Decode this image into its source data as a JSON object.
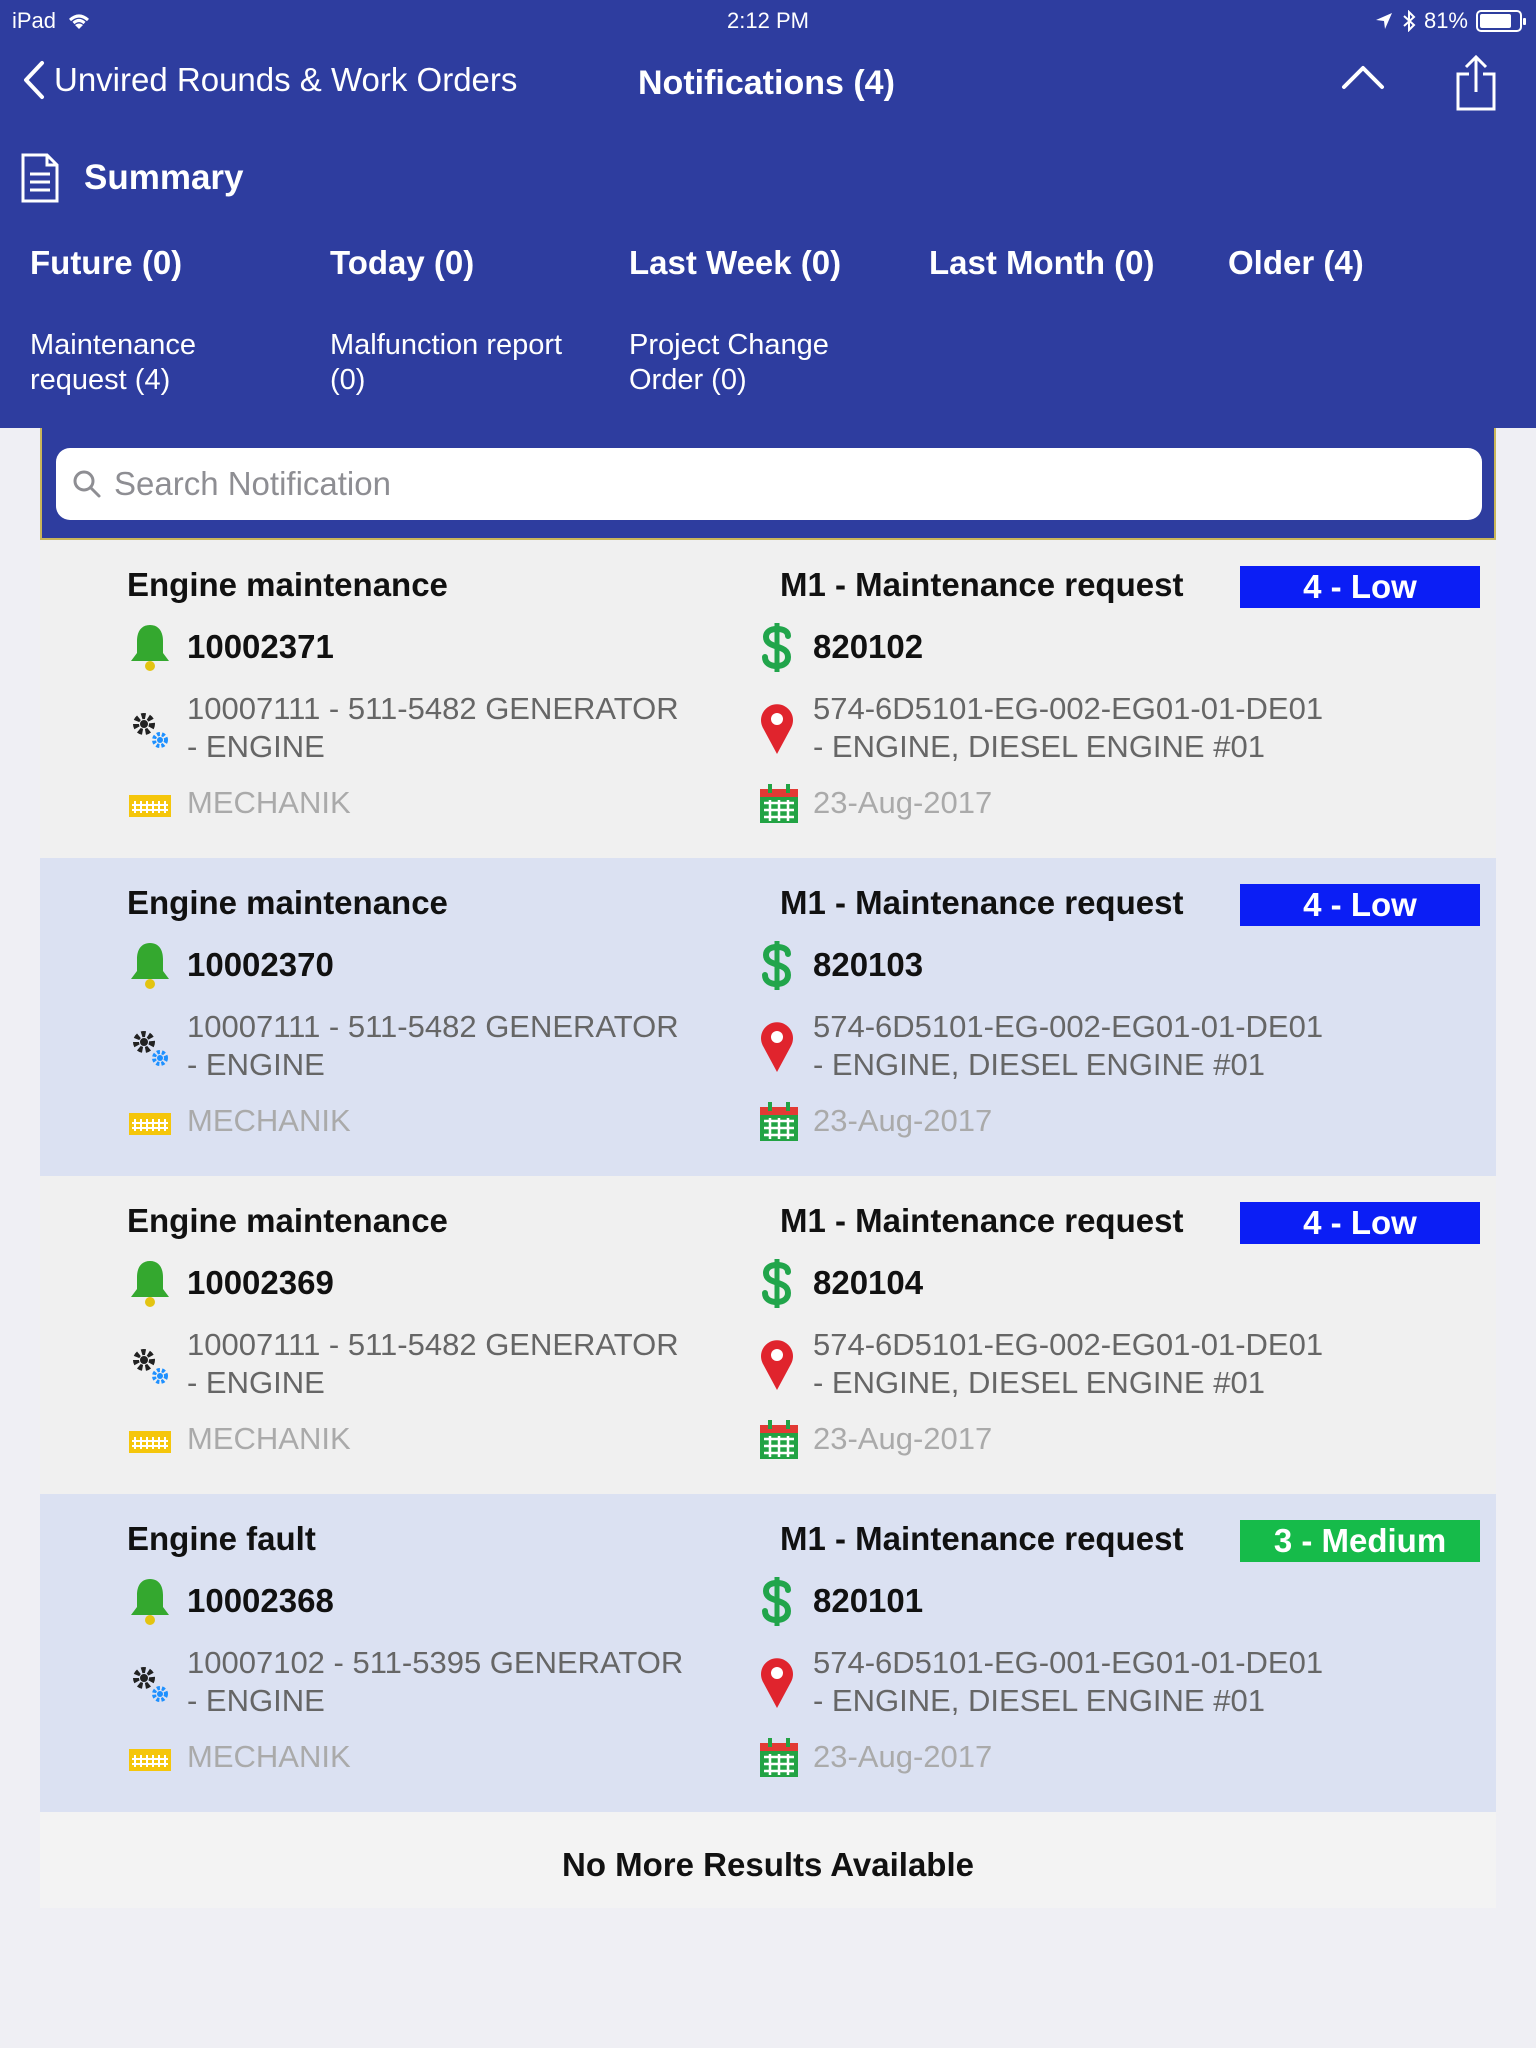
{
  "status_bar": {
    "device": "iPad",
    "time": "2:12 PM",
    "battery": "81%"
  },
  "nav": {
    "back_label": "Unvired Rounds & Work Orders",
    "title": "Notifications (4)"
  },
  "summary": {
    "label": "Summary"
  },
  "periods": [
    "Future (0)",
    "Today (0)",
    "Last Week (0)",
    "Last Month (0)",
    "Older (4)"
  ],
  "categories": [
    {
      "line1": "Maintenance",
      "line2": "request (4)"
    },
    {
      "line1": "Malfunction report",
      "line2": "(0)"
    },
    {
      "line1": "Project Change",
      "line2": "Order (0)"
    }
  ],
  "search": {
    "placeholder": "Search Notification"
  },
  "colors": {
    "header": "#2e3d9f",
    "priority_low": "#0000ff",
    "priority_medium": "#1db954"
  },
  "notifications": [
    {
      "title": "Engine maintenance",
      "type": "M1 - Maintenance request",
      "priority": "4 - Low",
      "priority_color": "#0b1ef5",
      "number": "10002371",
      "cost": "820102",
      "equipment_line1": "10007111 - 511-5482 GENERATOR",
      "equipment_line2": "- ENGINE",
      "location_line1": "574-6D5101-EG-002-EG01-01-DE01",
      "location_line2": "- ENGINE, DIESEL ENGINE #01",
      "workcenter": "MECHANIK",
      "date": "23-Aug-2017"
    },
    {
      "title": "Engine maintenance",
      "type": "M1 - Maintenance request",
      "priority": "4 - Low",
      "priority_color": "#0b1ef5",
      "number": "10002370",
      "cost": "820103",
      "equipment_line1": "10007111 - 511-5482 GENERATOR",
      "equipment_line2": "- ENGINE",
      "location_line1": "574-6D5101-EG-002-EG01-01-DE01",
      "location_line2": "- ENGINE, DIESEL ENGINE #01",
      "workcenter": "MECHANIK",
      "date": "23-Aug-2017"
    },
    {
      "title": "Engine maintenance",
      "type": "M1 - Maintenance request",
      "priority": "4 - Low",
      "priority_color": "#0b1ef5",
      "number": "10002369",
      "cost": "820104",
      "equipment_line1": "10007111 - 511-5482 GENERATOR",
      "equipment_line2": "- ENGINE",
      "location_line1": "574-6D5101-EG-002-EG01-01-DE01",
      "location_line2": "- ENGINE, DIESEL ENGINE #01",
      "workcenter": "MECHANIK",
      "date": "23-Aug-2017"
    },
    {
      "title": "Engine fault",
      "type": "M1 - Maintenance request",
      "priority": "3 - Medium",
      "priority_color": "#16bb4a",
      "number": "10002368",
      "cost": "820101",
      "equipment_line1": "10007102 - 511-5395 GENERATOR",
      "equipment_line2": "- ENGINE",
      "location_line1": "574-6D5101-EG-001-EG01-01-DE01",
      "location_line2": "- ENGINE, DIESEL ENGINE #01",
      "workcenter": "MECHANIK",
      "date": "23-Aug-2017"
    }
  ],
  "footer": {
    "text": "No More Results Available"
  }
}
